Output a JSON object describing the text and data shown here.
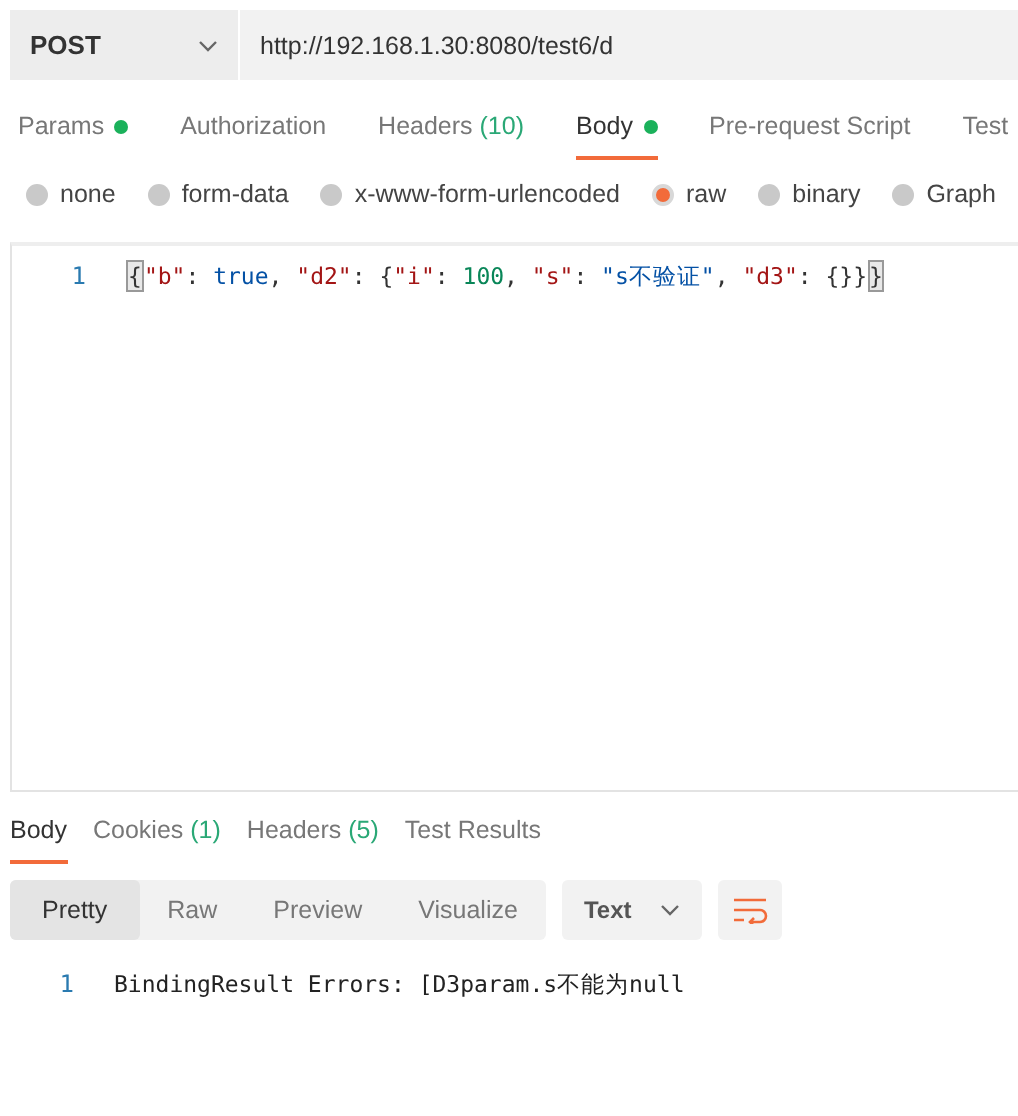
{
  "request": {
    "method": "POST",
    "url": "http://192.168.1.30:8080/test6/d"
  },
  "request_tabs": [
    {
      "label": "Params",
      "dot": true,
      "selected": false
    },
    {
      "label": "Authorization",
      "dot": false,
      "selected": false
    },
    {
      "label": "Headers",
      "count": "(10)",
      "dot": false,
      "selected": false
    },
    {
      "label": "Body",
      "dot": true,
      "selected": true
    },
    {
      "label": "Pre-request Script",
      "dot": false,
      "selected": false
    },
    {
      "label": "Test",
      "dot": false,
      "selected": false
    }
  ],
  "body_types": [
    {
      "label": "none",
      "selected": false
    },
    {
      "label": "form-data",
      "selected": false
    },
    {
      "label": "x-www-form-urlencoded",
      "selected": false
    },
    {
      "label": "raw",
      "selected": true
    },
    {
      "label": "binary",
      "selected": false
    },
    {
      "label": "Graph",
      "selected": false
    }
  ],
  "editor": {
    "lines": [
      {
        "number": "1",
        "tokens": [
          {
            "kind": "bracket",
            "text": "{"
          },
          {
            "kind": "key",
            "text": "\"b\""
          },
          {
            "kind": "punct",
            "text": ": "
          },
          {
            "kind": "bool",
            "text": "true"
          },
          {
            "kind": "punct",
            "text": ", "
          },
          {
            "kind": "key",
            "text": "\"d2\""
          },
          {
            "kind": "punct",
            "text": ": {"
          },
          {
            "kind": "key",
            "text": "\"i\""
          },
          {
            "kind": "punct",
            "text": ": "
          },
          {
            "kind": "number",
            "text": "100"
          },
          {
            "kind": "punct",
            "text": ", "
          },
          {
            "kind": "key",
            "text": "\"s\""
          },
          {
            "kind": "punct",
            "text": ": "
          },
          {
            "kind": "string",
            "text": "\"s不验证\""
          },
          {
            "kind": "punct",
            "text": ", "
          },
          {
            "kind": "key",
            "text": "\"d3\""
          },
          {
            "kind": "punct",
            "text": ": {}}"
          },
          {
            "kind": "bracket",
            "text": "}"
          }
        ]
      }
    ]
  },
  "response_tabs": [
    {
      "label": "Body",
      "selected": true
    },
    {
      "label": "Cookies",
      "count": "(1)",
      "selected": false
    },
    {
      "label": "Headers",
      "count": "(5)",
      "selected": false
    },
    {
      "label": "Test Results",
      "selected": false
    }
  ],
  "view_modes": [
    {
      "label": "Pretty",
      "selected": true
    },
    {
      "label": "Raw",
      "selected": false
    },
    {
      "label": "Preview",
      "selected": false
    },
    {
      "label": "Visualize",
      "selected": false
    }
  ],
  "format": "Text",
  "response": {
    "lines": [
      {
        "number": "1",
        "text": "BindingResult Errors: [D3param.s不能为null"
      }
    ]
  }
}
